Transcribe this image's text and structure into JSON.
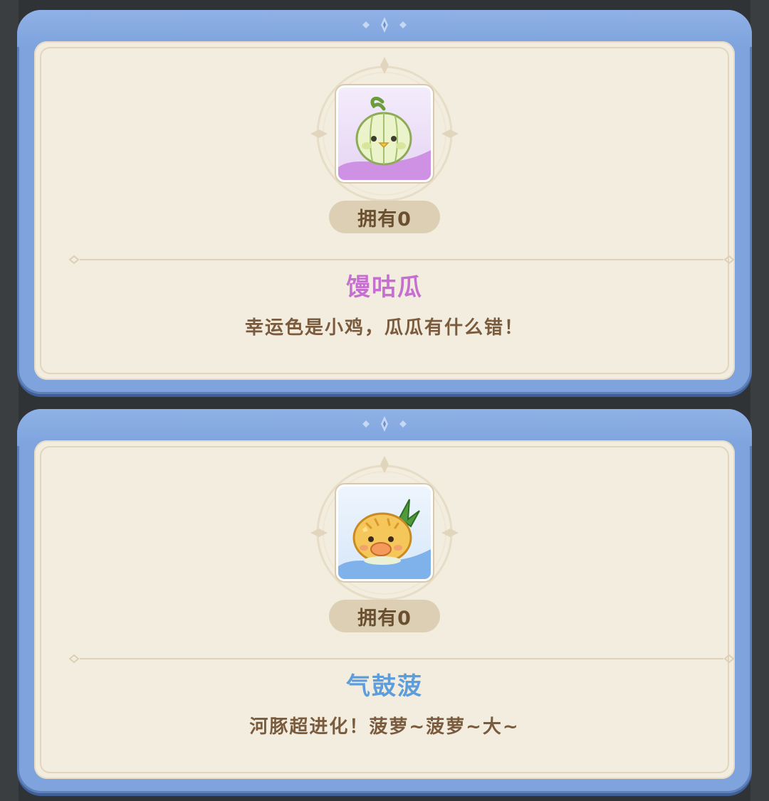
{
  "cards": [
    {
      "icon": "melon-chick-icon",
      "owned_label": "拥有0",
      "name": "馒咕瓜",
      "description": "幸运色是小鸡，瓜瓜有什么错！",
      "name_color": "#c56fcf",
      "frame_accent": "#c98be0"
    },
    {
      "icon": "pineapple-puffer-icon",
      "owned_label": "拥有0",
      "name": "气鼓菠",
      "description": "河豚超进化！菠萝~菠萝~大~",
      "name_color": "#5d9ddb",
      "frame_accent": "#7fb2ea"
    }
  ],
  "colors": {
    "card_blue": "#7ea3dd",
    "panel_cream": "#f3eddf",
    "owned_pill": "#dccfb4",
    "desc_brown": "#7a5b3d"
  }
}
